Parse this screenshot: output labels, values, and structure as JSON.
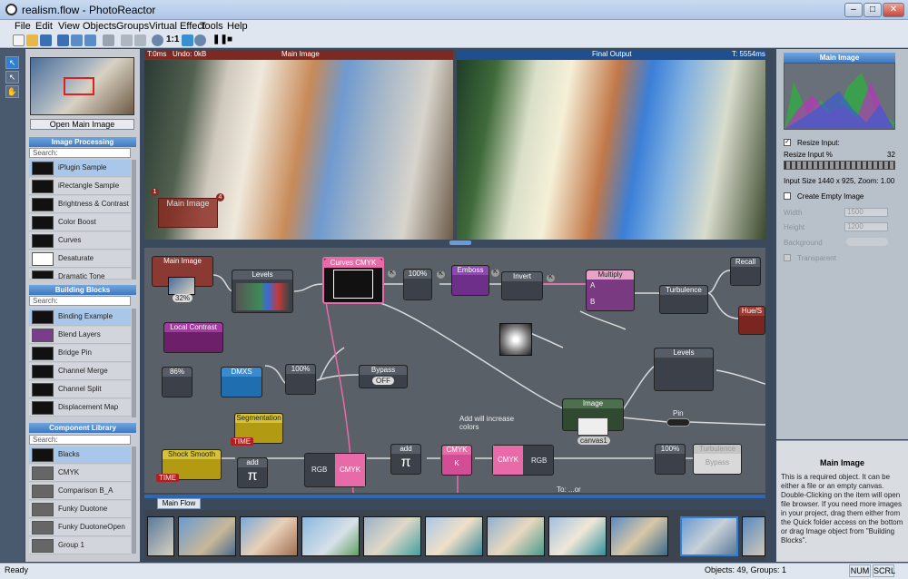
{
  "window": {
    "title": "realism.flow - PhotoReactor"
  },
  "menu": {
    "items": [
      "File",
      "Edit",
      "View",
      "Objects",
      "Groups",
      "Virtual Effect",
      "Tools",
      "Help"
    ]
  },
  "toolbar": {
    "zoom_label": "1:1"
  },
  "left": {
    "open_label": "Open Main Image",
    "image_processing": {
      "title": "Image Processing",
      "search": "Search:",
      "items": [
        "iPlugin Sample",
        "iRectangle Sample",
        "Brightness & Contrast",
        "Color Boost",
        "Curves",
        "Desaturate",
        "Dramatic Tone"
      ]
    },
    "building_blocks": {
      "title": "Building Blocks",
      "search": "Search:",
      "items": [
        "Binding Example",
        "Blend Layers",
        "Bridge Pin",
        "Channel Merge",
        "Channel Split",
        "Displacement Map"
      ]
    },
    "component_library": {
      "title": "Component Library",
      "search": "Search:",
      "items": [
        "Blacks",
        "CMYK",
        "Comparison B_A",
        "Funky Duotone",
        "Funky DuotoneOpen",
        "Group 1"
      ]
    }
  },
  "viewer": {
    "main_title": "Main Image",
    "final_title": "Final Output",
    "t_left": "T:0ms",
    "undo": "Undo: 0kB",
    "t_right": "T: 5554ms",
    "overlay_label": "Main Image",
    "badge1": "1",
    "badge4": "4"
  },
  "graph": {
    "main_image": "Main Image",
    "pct32": "32%",
    "levels": "Levels",
    "curves": "Curves CMYK",
    "pct100a": "100%",
    "emboss": "Emboss",
    "invert": "Invert",
    "multiply": "Multiply",
    "turbulence": "Turbulence",
    "recall": "Recall",
    "hue": "Hue/S",
    "local_contrast": "Local Contrast",
    "pct86": "86%",
    "dmxs": "DMXS",
    "pct100b": "100%",
    "bypass": "Bypass",
    "off": "OFF",
    "levels2": "Levels",
    "segmentation": "Segmentation",
    "time1": "TIME",
    "note": "Add will increase colors",
    "image": "Image",
    "canvas": "canvas1",
    "pin": "Pin",
    "shock": "Shock Smooth",
    "time2": "TIME",
    "add1": "add",
    "rgb1": "RGB",
    "cmyk1": "CMYK",
    "add2": "add",
    "cmyk2": "CMYK",
    "k": "K",
    "cmyk3": "CMYK",
    "rgb2": "RGB",
    "pct100c": "100%",
    "turbulence2": "Turbulence",
    "bypass2": "Bypass",
    "trunc": "To: ...or",
    "ka": "K",
    "kb": "K",
    "kc": "K",
    "kd": "K",
    "ma": "A",
    "mb": "B",
    "pi1": "π",
    "pi2": "π"
  },
  "film": {
    "tab": "Main Flow"
  },
  "right": {
    "title": "Main Image",
    "resize_input": "Resize Input:",
    "resize_pct": "Resize Input %",
    "resize_val": "32",
    "input_size": "Input Size 1440 x 925, Zoom: 1.00",
    "create_empty": "Create Empty Image",
    "width": "Width",
    "width_val": "1500",
    "height": "Height",
    "height_val": "1200",
    "background": "Background",
    "transparent": "Transparent",
    "help_title": "Main Image",
    "help_text": "This is a required object. It can be either a file or an empty canvas. Double-Clicking on the item will open file browser. If you need more images in your project, drag them either from the Quick folder access on the bottom or drag Image object from \"Building Blocks\"."
  },
  "status": {
    "ready": "Ready",
    "objects": "Objects: 49, Groups: 1",
    "num": "NUM",
    "scrl": "SCRL"
  }
}
